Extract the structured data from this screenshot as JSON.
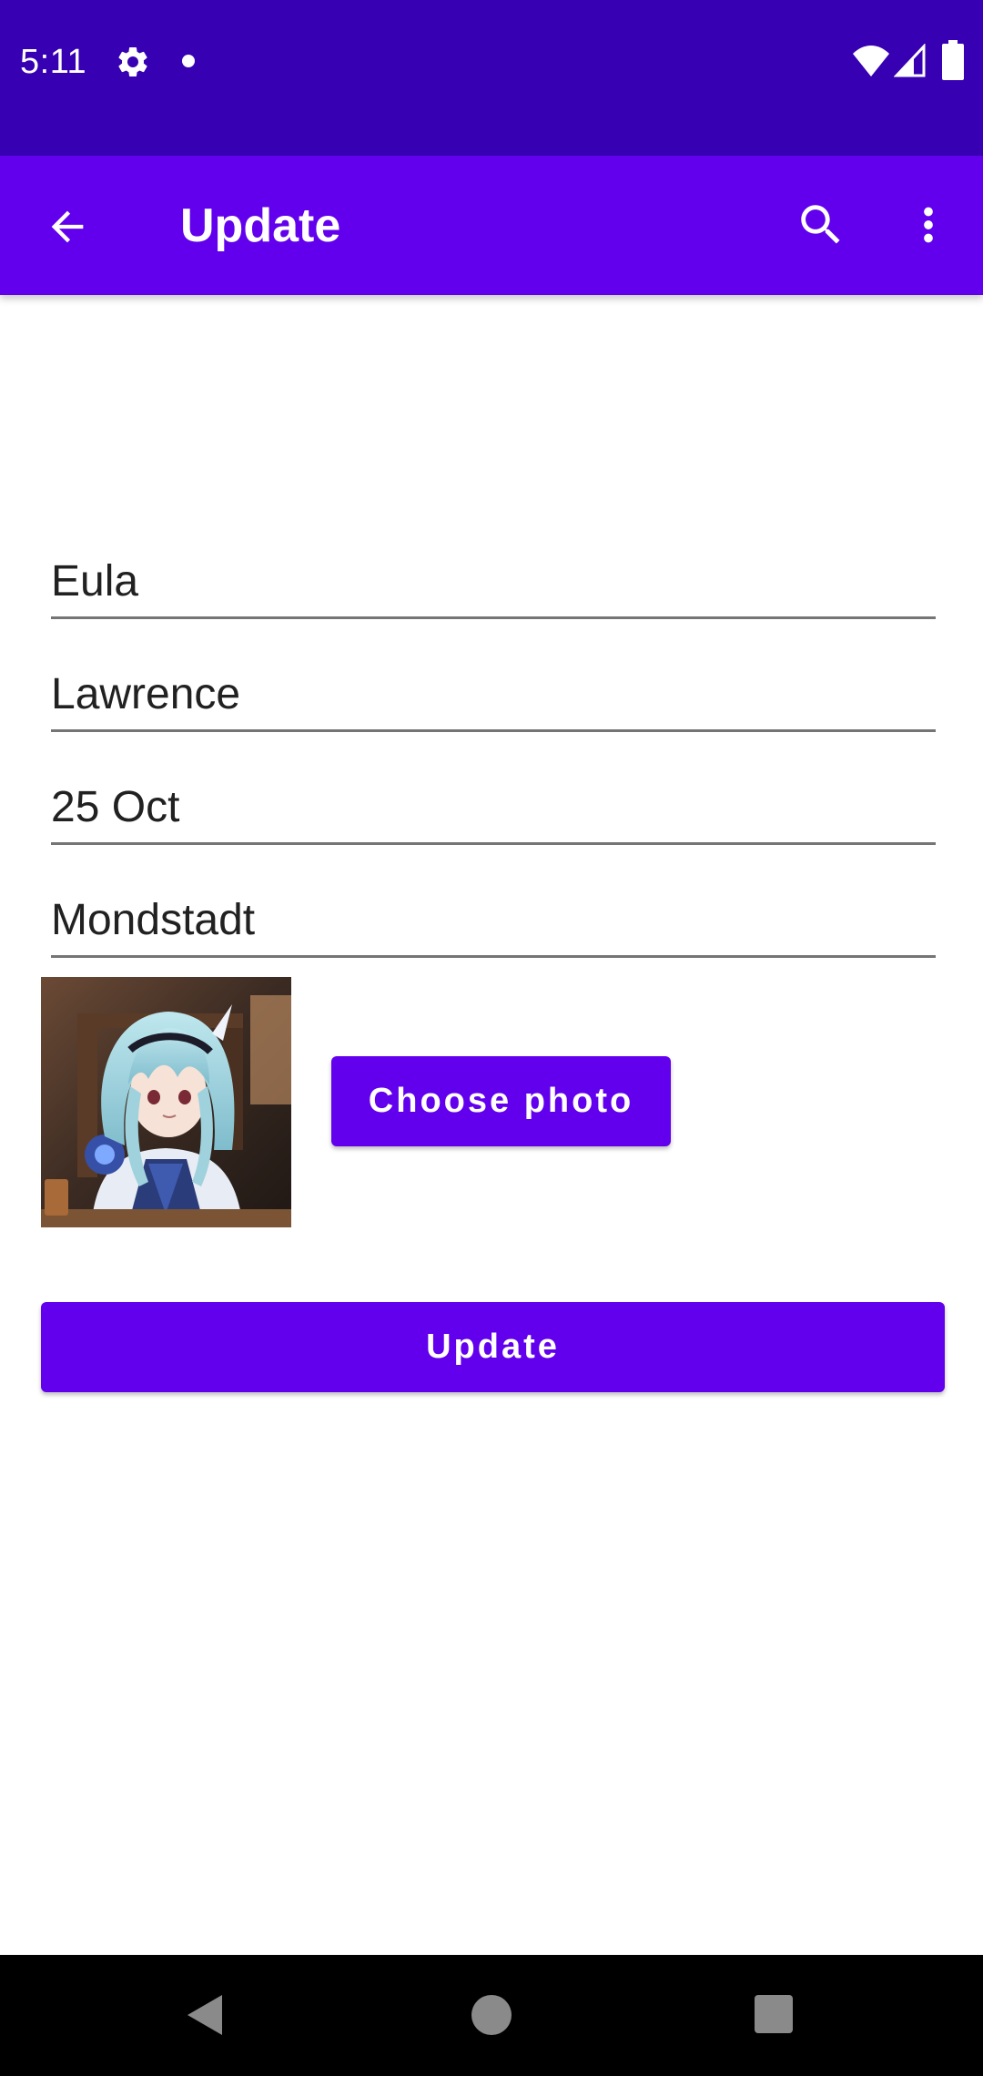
{
  "status_bar": {
    "time": "5:11",
    "icons": [
      "gear-icon",
      "notification-dot-icon",
      "wifi-icon",
      "signal-icon",
      "battery-icon"
    ],
    "background": "#3700B3"
  },
  "app_bar": {
    "title": "Update",
    "background": "#6200EE",
    "icons": [
      "arrow-back-icon",
      "search-icon",
      "more-vert-icon"
    ]
  },
  "form": {
    "first_name": "Eula",
    "last_name": "Lawrence",
    "birthday": "25 Oct",
    "region": "Mondstadt"
  },
  "photo": {
    "icon": "character-portrait-image"
  },
  "buttons": {
    "choose_photo": "Choose photo",
    "update": "Update",
    "accent": "#6200EE"
  },
  "nav_bar": {
    "icons": [
      "back-triangle-icon",
      "home-circle-icon",
      "recents-square-icon"
    ]
  }
}
